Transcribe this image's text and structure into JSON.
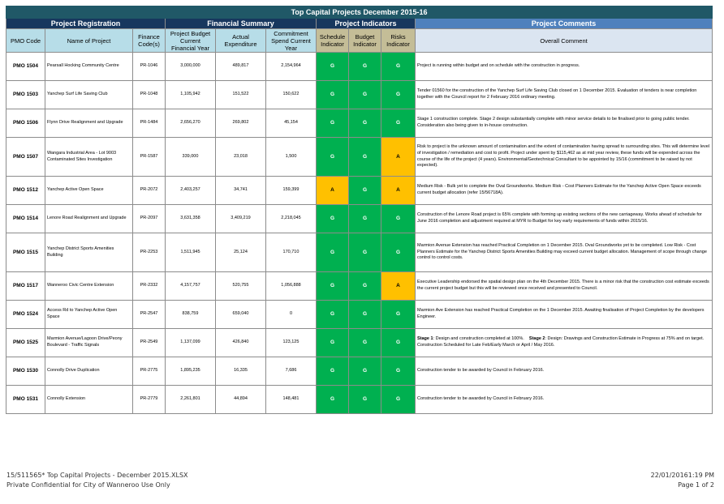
{
  "title": "Top Capital  Projects     December 2015-16",
  "groups": {
    "registration": "Project Registration",
    "financial": "Financial Summary",
    "indicators": "Project Indicators",
    "comments": "Project Comments"
  },
  "headers": {
    "pmo_code": "PMO Code",
    "name": "Name of Project",
    "finance_code": "Finance Code(s)",
    "budget": "Project Budget Current Financial Year",
    "actual": "Actual Expenditure",
    "commitment": "Commitment Spend Current Year",
    "schedule": "Schedule Indicator",
    "budget_ind": "Budget Indicator",
    "risks": "Risks Indicator",
    "comment": "Overall Comment"
  },
  "rows": [
    {
      "pmo": "PMO 1504",
      "name": "Pearsall Hocking Community Centre",
      "code": "PR-1046",
      "budget": "3,000,000",
      "actual": "489,817",
      "commit": "2,154,964",
      "s": "G",
      "b": "G",
      "r": "G",
      "comment": "Project is running within budget and on schedule with the construction in progress."
    },
    {
      "pmo": "PMO 1503",
      "name": "Yanchep Surf Life Saving Club",
      "code": "PR-1048",
      "budget": "1,105,942",
      "actual": "151,522",
      "commit": "150,622",
      "s": "G",
      "b": "G",
      "r": "G",
      "comment": "Tender 01560 for the construction of the Yanchep Surf Life Saving Club closed on 1 December 2015. Evaluation of tenders is near completion together with the Council report for 2 February 2016 ordinary meeting."
    },
    {
      "pmo": "PMO 1506",
      "name": "Flynn Drive Realignment and Upgrade",
      "code": "PR-1484",
      "budget": "2,656,270",
      "actual": "269,802",
      "commit": "45,154",
      "s": "G",
      "b": "G",
      "r": "G",
      "comment": "Stage 1 construction complete. Stage 2 design substantially complete with minor service details to be finalised prior to going public tender. Consideration also being given to in-house construction."
    },
    {
      "pmo": "PMO 1507",
      "name": "Wangara Industrial Area - Lot 9003 Contaminated Sites Investigation",
      "code": "PR-1587",
      "budget": "339,000",
      "actual": "23,018",
      "commit": "1,500",
      "s": "G",
      "b": "G",
      "r": "A",
      "comment": "Risk to project is the unknown amount of contamination and the extent of contamination having spread to surrounding sites. This will determine level of investigation / remediation and cost to profit. Project under spent by $115,462 as at mid year review, these funds will be expended across the course of the life of the project (4 years). Environmental/Geotechnical Consultant to be appointed by 15/16 (commitment to be raised by not expected)."
    },
    {
      "pmo": "PMO 1512",
      "name": "Yanchep Active Open Space",
      "code": "PR-2072",
      "budget": "2,403,257",
      "actual": "34,741",
      "commit": "159,399",
      "s": "A",
      "b": "G",
      "r": "A",
      "comment": "Medium Risk - Bulk yet to complete the Oval Groundworks. Medium Risk - Cost Planners Estimate for the Yanchep Active Open Space exceeds current budget allocation (refer 15/56718A)."
    },
    {
      "pmo": "PMO 1514",
      "name": "Lenore Road Realignment and Upgrade",
      "code": "PR-2097",
      "budget": "3,631,358",
      "actual": "3,409,219",
      "commit": "2,218,045",
      "s": "G",
      "b": "G",
      "r": "G",
      "comment": "Construction of the Lenore Road project is 65% complete with forming up existing sections of the new carriageway. Works ahead of schedule for June 2016 completion and adjustment required at MYR to Budget for key early requirements of funds within 2015/16."
    },
    {
      "pmo": "PMO 1515",
      "name": "Yanchep District Sports Amenities Building",
      "code": "PR-2253",
      "budget": "1,511,945",
      "actual": "25,124",
      "commit": "170,710",
      "s": "G",
      "b": "G",
      "r": "G",
      "comment": "Marmion Avenue Extension has reached Practical Completion on 1 December 2015. Oval Groundworks yet to be completed. Low Risk - Cost Planners Estimate for the Yanchep District Sports Amenities Building may exceed current budget allocation. Management of scope through change control to control costs."
    },
    {
      "pmo": "PMO 1517",
      "name": "Wanneroo Civic Centre Extension",
      "code": "PR-2332",
      "budget": "4,157,757",
      "actual": "520,755",
      "commit": "1,056,888",
      "s": "G",
      "b": "G",
      "r": "A",
      "comment": "Executive Leadership endorsed the spatial design plan on the 4th December 2015. There is a minor risk that the construction cost estimate exceeds the current project budget but this will be reviewed once received and presented to Council."
    },
    {
      "pmo": "PMO 1524",
      "name": "Access Rd to Yanchep Active Open Space",
      "code": "PR-2547",
      "budget": "838,759",
      "actual": "659,040",
      "commit": "0",
      "s": "G",
      "b": "G",
      "r": "G",
      "comment": "Marmion Ave Extension has reached Practical Completion on the 1 December 2015. Awaiting finalisation of Project Completion by the developers Engineer."
    },
    {
      "pmo": "PMO 1525",
      "name": "Marmion Avenue/Lagoon Drive/Peony Boulevard - Traffic Signals",
      "code": "PR-2549",
      "budget": "1,137,099",
      "actual": "426,840",
      "commit": "123,125",
      "s": "G",
      "b": "G",
      "r": "G",
      "comment_b1": "Stage 1",
      "comment_t1": ": Design and construction completed at 100%.",
      "comment_b2": "Stage 2",
      "comment_t2": ": Design: Drawings and Construction Estimate in Progress at 75% and on target. Construction Scheduled for Late Feb/Early March or April / May 2016."
    },
    {
      "pmo": "PMO 1530",
      "name": "Connolly Drive Duplication",
      "code": "PR-2775",
      "budget": "1,895,235",
      "actual": "16,335",
      "commit": "7,686",
      "s": "G",
      "b": "G",
      "r": "G",
      "comment": "Construction tender to be awarded by Council in February 2016."
    },
    {
      "pmo": "PMO 1531",
      "name": "Connolly Extension",
      "code": "PR-2779",
      "budget": "2,261,801",
      "actual": "44,894",
      "commit": "148,481",
      "s": "G",
      "b": "G",
      "r": "G",
      "comment": "Construction tender to be awarded by Council in February 2016."
    }
  ],
  "footer": {
    "file": "15/511565* Top Capital Projects - December 2015.XLSX",
    "confidential": "Private Confidential for City of Wanneroo Use Only",
    "datetime": "22/01/20161:19 PM",
    "page": "Page 1 of 2"
  }
}
